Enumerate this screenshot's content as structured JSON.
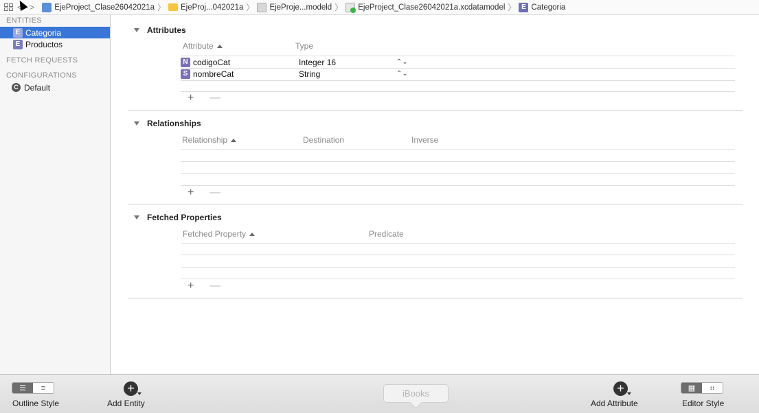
{
  "jumpbar": {
    "crumbs": [
      "EjeProject_Clase26042021a",
      "EjeProj...042021a",
      "EjeProje...modeld",
      "EjeProject_Clase26042021a.xcdatamodel",
      "Categoria"
    ],
    "entity_badge": "E"
  },
  "sidebar": {
    "entities_header": "ENTITIES",
    "entities": [
      {
        "badge": "E",
        "label": "Categoria"
      },
      {
        "badge": "E",
        "label": "Productos"
      }
    ],
    "fetch_requests_header": "FETCH REQUESTS",
    "configurations_header": "CONFIGURATIONS",
    "configurations": [
      {
        "badge": "C",
        "label": "Default"
      }
    ]
  },
  "attributes": {
    "title": "Attributes",
    "col_attribute": "Attribute",
    "col_type": "Type",
    "rows": [
      {
        "badge": "N",
        "name": "codigoCat",
        "type": "Integer 16"
      },
      {
        "badge": "S",
        "name": "nombreCat",
        "type": "String"
      }
    ]
  },
  "relationships": {
    "title": "Relationships",
    "col_relationship": "Relationship",
    "col_destination": "Destination",
    "col_inverse": "Inverse"
  },
  "fetched": {
    "title": "Fetched Properties",
    "col_property": "Fetched Property",
    "col_predicate": "Predicate"
  },
  "controls": {
    "add": "+",
    "remove": "—",
    "stepper": "⌃⌄"
  },
  "toolbar": {
    "outline_style": "Outline Style",
    "add_entity": "Add Entity",
    "ibooks": "iBooks",
    "add_attribute": "Add Attribute",
    "editor_style": "Editor Style"
  }
}
